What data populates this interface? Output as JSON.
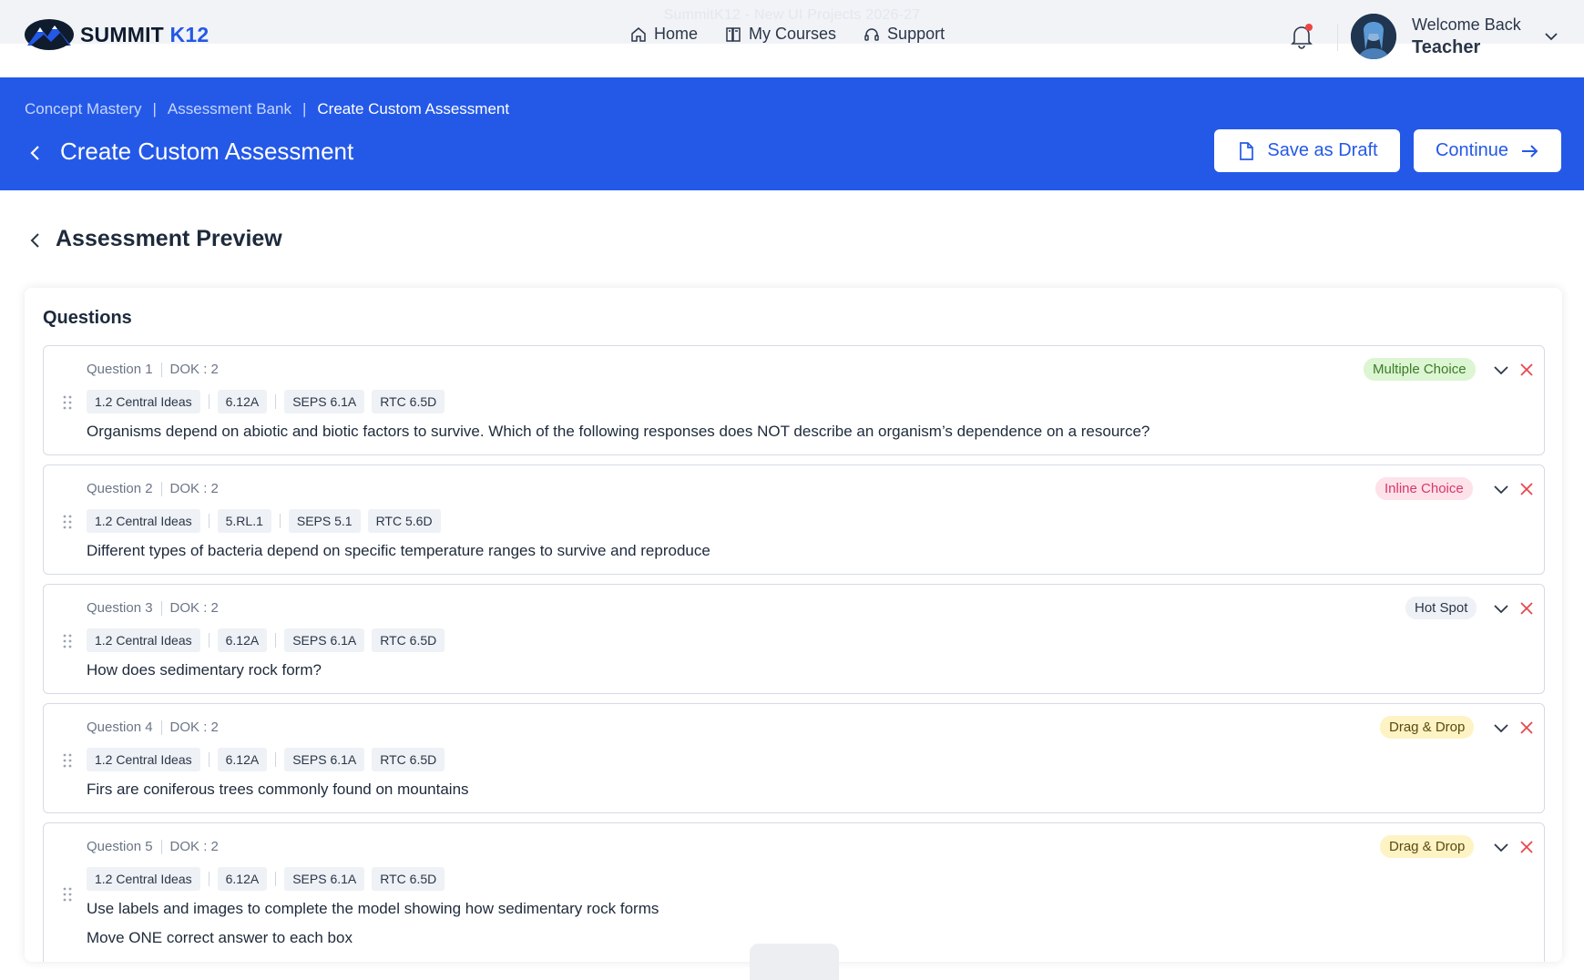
{
  "window": {
    "title": "SummitK12 - New UI Projects 2026-27"
  },
  "brand": {
    "name": "SUMMIT",
    "suffix": "K12",
    "accent": "#2458e6"
  },
  "nav": {
    "home": "Home",
    "courses": "My Courses",
    "support": "Support"
  },
  "user": {
    "greeting": "Welcome Back",
    "role": "Teacher"
  },
  "breadcrumb": {
    "items": [
      "Concept Mastery",
      "Assessment Bank",
      "Create Custom Assessment"
    ],
    "separator": "|"
  },
  "header": {
    "title": "Create Custom Assessment",
    "save_draft": "Save as Draft",
    "continue": "Continue",
    "bg_color": "#2459e8"
  },
  "preview": {
    "title": "Assessment Preview"
  },
  "questions_section": {
    "title": "Questions"
  },
  "questions": [
    {
      "number": "Question 1",
      "dok": "DOK : 2",
      "tags": [
        "1.2 Central Ideas",
        "6.12A",
        "SEPS 6.1A",
        "RTC 6.5D"
      ],
      "type": "Multiple Choice",
      "text": "Organisms depend on abiotic and biotic factors to survive. Which of the following responses does NOT describe an organism’s dependence on a resource?"
    },
    {
      "number": "Question 2",
      "dok": "DOK : 2",
      "tags": [
        "1.2 Central Ideas",
        "5.RL.1",
        "SEPS 5.1",
        "RTC 5.6D"
      ],
      "type": "Inline Choice",
      "text": "Different types of bacteria depend on specific temperature ranges to survive and reproduce"
    },
    {
      "number": "Question 3",
      "dok": "DOK : 2",
      "tags": [
        "1.2 Central Ideas",
        "6.12A",
        "SEPS 6.1A",
        "RTC 6.5D"
      ],
      "type": "Hot Spot",
      "text": "How does sedimentary rock form?"
    },
    {
      "number": "Question 4",
      "dok": "DOK : 2",
      "tags": [
        "1.2 Central Ideas",
        "6.12A",
        "SEPS 6.1A",
        "RTC 6.5D"
      ],
      "type": "Drag & Drop",
      "text": "Firs are coniferous trees commonly found on mountains"
    },
    {
      "number": "Question 5",
      "dok": "DOK : 2",
      "tags": [
        "1.2 Central Ideas",
        "6.12A",
        "SEPS 6.1A",
        "RTC 6.5D"
      ],
      "type": "Drag & Drop",
      "text": "Use labels and images to complete the model showing how sedimentary rock forms",
      "text2": "Move ONE correct answer to each box"
    }
  ],
  "icons": {
    "home": "home-icon",
    "courses": "book-icon",
    "support": "headset-icon",
    "notifications": "bell-icon",
    "drag": "drag-handle-icon",
    "expand": "chevron-down-icon",
    "remove": "close-icon"
  }
}
